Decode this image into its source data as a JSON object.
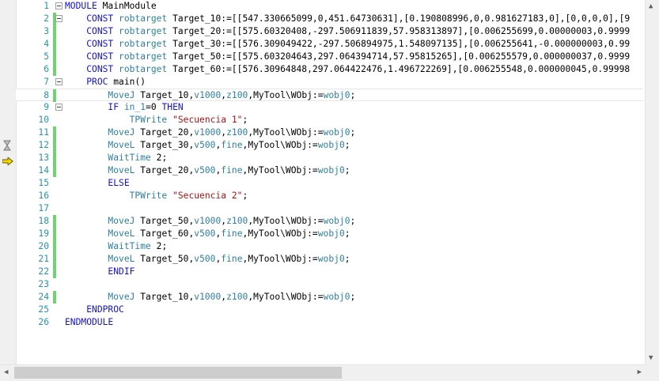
{
  "editor": {
    "lines": [
      {
        "num": "1",
        "fold": true,
        "mark": false,
        "indent": "",
        "tokens": [
          [
            "k",
            "MODULE"
          ],
          [
            "n",
            " MainModule"
          ]
        ]
      },
      {
        "num": "2",
        "fold": true,
        "mark": true,
        "indent": "    ",
        "tokens": [
          [
            "k",
            "CONST"
          ],
          [
            "n",
            " "
          ],
          [
            "t",
            "robtarget"
          ],
          [
            "n",
            " Target_10:=[[547.330665099,0,451.64730631],[0.190808996,0,0.981627183,0],[0,0,0,0],[9"
          ]
        ]
      },
      {
        "num": "3",
        "fold": false,
        "mark": true,
        "indent": "    ",
        "tokens": [
          [
            "k",
            "CONST"
          ],
          [
            "n",
            " "
          ],
          [
            "t",
            "robtarget"
          ],
          [
            "n",
            " Target_20:=[[575.60320408,-297.506911839,57.958313897],[0.006255699,0.00000003,0.9999"
          ]
        ]
      },
      {
        "num": "4",
        "fold": false,
        "mark": true,
        "indent": "    ",
        "tokens": [
          [
            "k",
            "CONST"
          ],
          [
            "n",
            " "
          ],
          [
            "t",
            "robtarget"
          ],
          [
            "n",
            " Target_30:=[[576.309049422,-297.506894975,1.548097135],[0.006255641,-0.000000003,0.99"
          ]
        ]
      },
      {
        "num": "5",
        "fold": false,
        "mark": true,
        "indent": "    ",
        "tokens": [
          [
            "k",
            "CONST"
          ],
          [
            "n",
            " "
          ],
          [
            "t",
            "robtarget"
          ],
          [
            "n",
            " Target_50:=[[575.603204643,297.064394714,57.95815265],[0.006255579,0.000000037,0.9999"
          ]
        ]
      },
      {
        "num": "6",
        "fold": false,
        "mark": true,
        "indent": "    ",
        "tokens": [
          [
            "k",
            "CONST"
          ],
          [
            "n",
            " "
          ],
          [
            "t",
            "robtarget"
          ],
          [
            "n",
            " Target_60:=[[576.30964848,297.064422476,1.496722269],[0.006255548,0.000000045,0.99998"
          ]
        ]
      },
      {
        "num": "7",
        "fold": true,
        "mark": false,
        "indent": "    ",
        "tokens": [
          [
            "k",
            "PROC"
          ],
          [
            "n",
            " main()"
          ]
        ]
      },
      {
        "num": "8",
        "fold": false,
        "mark": true,
        "indent": "        ",
        "current": true,
        "tokens": [
          [
            "t",
            "MoveJ"
          ],
          [
            "n",
            " Target_10,"
          ],
          [
            "p",
            "v1000"
          ],
          [
            "n",
            ","
          ],
          [
            "p",
            "z100"
          ],
          [
            "n",
            ",MyTool\\WObj:="
          ],
          [
            "p",
            "wobj0"
          ],
          [
            "n",
            ";"
          ]
        ]
      },
      {
        "num": "9",
        "fold": true,
        "mark": false,
        "indent": "        ",
        "tokens": [
          [
            "k",
            "IF"
          ],
          [
            "n",
            " "
          ],
          [
            "t",
            "in_1"
          ],
          [
            "n",
            "=0 "
          ],
          [
            "k",
            "THEN"
          ]
        ]
      },
      {
        "num": "10",
        "fold": false,
        "mark": false,
        "indent": "            ",
        "tokens": [
          [
            "t",
            "TPWrite"
          ],
          [
            "n",
            " "
          ],
          [
            "s",
            "\"Secuencia 1\""
          ],
          [
            "n",
            ";"
          ]
        ]
      },
      {
        "num": "11",
        "fold": false,
        "mark": true,
        "indent": "        ",
        "tokens": [
          [
            "t",
            "MoveJ"
          ],
          [
            "n",
            " Target_20,"
          ],
          [
            "p",
            "v1000"
          ],
          [
            "n",
            ","
          ],
          [
            "p",
            "z100"
          ],
          [
            "n",
            ",MyTool\\WObj:="
          ],
          [
            "p",
            "wobj0"
          ],
          [
            "n",
            ";"
          ]
        ]
      },
      {
        "num": "12",
        "fold": false,
        "mark": true,
        "indent": "        ",
        "tokens": [
          [
            "t",
            "MoveL"
          ],
          [
            "n",
            " Target_30,"
          ],
          [
            "p",
            "v500"
          ],
          [
            "n",
            ","
          ],
          [
            "p",
            "fine"
          ],
          [
            "n",
            ",MyTool\\WObj:="
          ],
          [
            "p",
            "wobj0"
          ],
          [
            "n",
            ";"
          ]
        ]
      },
      {
        "num": "13",
        "fold": false,
        "mark": true,
        "indent": "        ",
        "tokens": [
          [
            "t",
            "WaitTime"
          ],
          [
            "n",
            " 2;"
          ]
        ]
      },
      {
        "num": "14",
        "fold": false,
        "mark": true,
        "indent": "        ",
        "tokens": [
          [
            "t",
            "MoveL"
          ],
          [
            "n",
            " Target_20,"
          ],
          [
            "p",
            "v500"
          ],
          [
            "n",
            ","
          ],
          [
            "p",
            "fine"
          ],
          [
            "n",
            ",MyTool\\WObj:="
          ],
          [
            "p",
            "wobj0"
          ],
          [
            "n",
            ";"
          ]
        ]
      },
      {
        "num": "15",
        "fold": false,
        "mark": false,
        "indent": "        ",
        "tokens": [
          [
            "k",
            "ELSE"
          ]
        ]
      },
      {
        "num": "16",
        "fold": false,
        "mark": false,
        "indent": "            ",
        "tokens": [
          [
            "t",
            "TPWrite"
          ],
          [
            "n",
            " "
          ],
          [
            "s",
            "\"Secuencia 2\""
          ],
          [
            "n",
            ";"
          ]
        ]
      },
      {
        "num": "17",
        "fold": false,
        "mark": false,
        "indent": "",
        "tokens": []
      },
      {
        "num": "18",
        "fold": false,
        "mark": true,
        "indent": "        ",
        "tokens": [
          [
            "t",
            "MoveJ"
          ],
          [
            "n",
            " Target_50,"
          ],
          [
            "p",
            "v1000"
          ],
          [
            "n",
            ","
          ],
          [
            "p",
            "z100"
          ],
          [
            "n",
            ",MyTool\\WObj:="
          ],
          [
            "p",
            "wobj0"
          ],
          [
            "n",
            ";"
          ]
        ]
      },
      {
        "num": "19",
        "fold": false,
        "mark": true,
        "indent": "        ",
        "tokens": [
          [
            "t",
            "MoveL"
          ],
          [
            "n",
            " Target_60,"
          ],
          [
            "p",
            "v500"
          ],
          [
            "n",
            ","
          ],
          [
            "p",
            "fine"
          ],
          [
            "n",
            ",MyTool\\WObj:="
          ],
          [
            "p",
            "wobj0"
          ],
          [
            "n",
            ";"
          ]
        ]
      },
      {
        "num": "20",
        "fold": false,
        "mark": true,
        "indent": "        ",
        "tokens": [
          [
            "t",
            "WaitTime"
          ],
          [
            "n",
            " 2;"
          ]
        ]
      },
      {
        "num": "21",
        "fold": false,
        "mark": true,
        "indent": "        ",
        "tokens": [
          [
            "t",
            "MoveL"
          ],
          [
            "n",
            " Target_50,"
          ],
          [
            "p",
            "v500"
          ],
          [
            "n",
            ","
          ],
          [
            "p",
            "fine"
          ],
          [
            "n",
            ",MyTool\\WObj:="
          ],
          [
            "p",
            "wobj0"
          ],
          [
            "n",
            ";"
          ]
        ]
      },
      {
        "num": "22",
        "fold": false,
        "mark": true,
        "indent": "        ",
        "tokens": [
          [
            "k",
            "ENDIF"
          ]
        ]
      },
      {
        "num": "23",
        "fold": false,
        "mark": false,
        "indent": "",
        "tokens": []
      },
      {
        "num": "24",
        "fold": false,
        "mark": true,
        "indent": "        ",
        "tokens": [
          [
            "t",
            "MoveJ"
          ],
          [
            "n",
            " Target_10,"
          ],
          [
            "p",
            "v1000"
          ],
          [
            "n",
            ","
          ],
          [
            "p",
            "z100"
          ],
          [
            "n",
            ",MyTool\\WObj:="
          ],
          [
            "p",
            "wobj0"
          ],
          [
            "n",
            ";"
          ]
        ]
      },
      {
        "num": "25",
        "fold": false,
        "mark": false,
        "indent": "    ",
        "tokens": [
          [
            "k",
            "ENDPROC"
          ]
        ]
      },
      {
        "num": "26",
        "fold": false,
        "mark": false,
        "indent": "",
        "tokens": [
          [
            "k",
            "ENDMODULE"
          ]
        ]
      }
    ]
  },
  "gutter_icons": [
    "hourglass-icon",
    "program-pointer-arrow-icon"
  ],
  "colors": {
    "keyword": "#1414c8",
    "type": "#2f7fa3",
    "string": "#a31515",
    "line_number": "#2b91af",
    "change_mark": "#6fd36f"
  }
}
